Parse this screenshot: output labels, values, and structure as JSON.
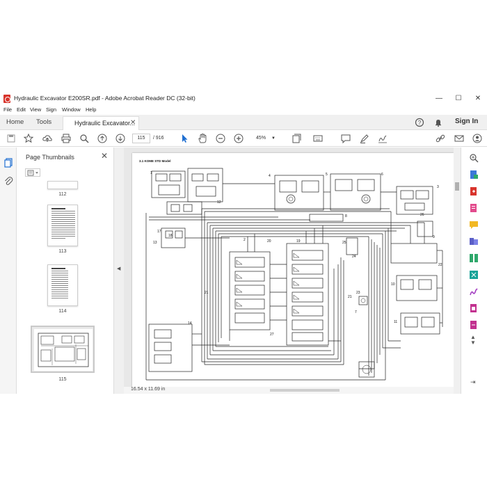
{
  "window": {
    "title": "Hydraulic Excavator E200SR.pdf - Adobe Acrobat Reader DC (32-bit)",
    "minimize": "—",
    "maximize": "☐",
    "close": "✕"
  },
  "menu": [
    "File",
    "Edit",
    "View",
    "Sign",
    "Window",
    "Help"
  ],
  "tabs": {
    "home": "Home",
    "tools": "Tools",
    "document": "Hydraulic Excavator...",
    "document_close": "✕",
    "sign_in": "Sign In"
  },
  "toolbar": {
    "current_page": "115",
    "total_pages": "/ 916",
    "zoom": "45%"
  },
  "thumbnails": {
    "title": "Page Thumbnails",
    "close": "✕",
    "items": [
      {
        "label": "112"
      },
      {
        "label": "113"
      },
      {
        "label": "114"
      },
      {
        "label": "115"
      }
    ]
  },
  "document": {
    "heading": "3.1 KOME STD Model",
    "page_size": "16.54 x 11.69 in",
    "callouts": [
      "1",
      "2",
      "3",
      "4",
      "5",
      "6",
      "7",
      "8",
      "9",
      "10",
      "11",
      "12",
      "13",
      "14",
      "15",
      "16",
      "17",
      "18",
      "19",
      "20",
      "21",
      "22",
      "23",
      "24",
      "25",
      "26",
      "27",
      "28"
    ]
  },
  "colors": {
    "accent_blue": "#1f6fd1",
    "brand_red": "#d8342c",
    "schematic_line": "#222222"
  }
}
